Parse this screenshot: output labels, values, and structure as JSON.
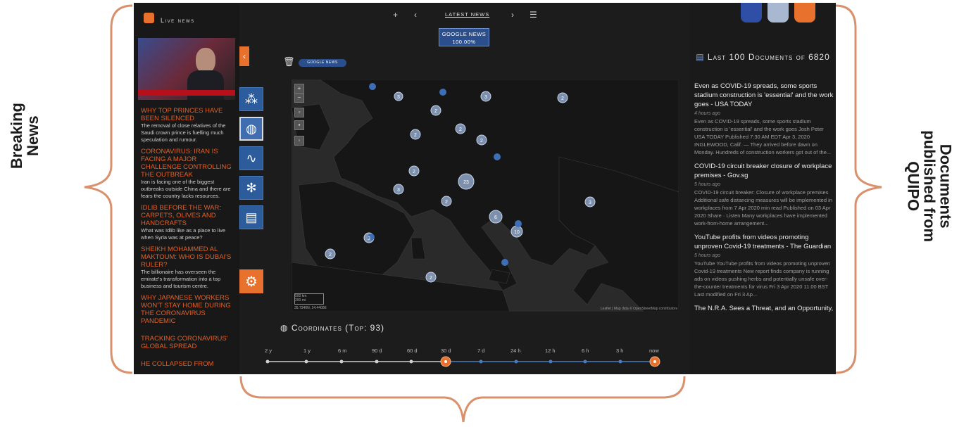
{
  "annotations": {
    "left": "Breaking News",
    "right": "Documents published from QUIPO"
  },
  "colors": {
    "accent": "#e8712d",
    "blue": "#2d5c9c",
    "bracket": "#d9906d"
  },
  "left_panel": {
    "title": "Live news",
    "news": [
      {
        "headline": "Why top princes have been silenced",
        "body": "The removal of close relatives of the Saudi crown prince is fuelling much speculation and rumour."
      },
      {
        "headline": "Coronavirus: Iran is facing a major challenge controlling the outbreak",
        "body": "Iran is facing one of the biggest outbreaks outside China and there are fears the country lacks resources."
      },
      {
        "headline": "Idlib before the war: Carpets, olives and handcrafts",
        "body": "What was Idlib like as a place to live when Syria was at peace?"
      },
      {
        "headline": "Sheikh Mohammed al Maktoum: Who is Dubai's ruler?",
        "body": "The billionaire has overseen the emirate's transformation into a top business and tourism centre."
      },
      {
        "headline": "Why Japanese workers won't stay home during the coronavirus pandemic",
        "body": ""
      },
      {
        "headline": "Tracking coronavirus' global spread",
        "body": ""
      },
      {
        "headline": "He collapsed from",
        "body": ""
      }
    ]
  },
  "center": {
    "nav": {
      "plus": "+",
      "prev": "‹",
      "title": "LATEST NEWS",
      "next": "›",
      "list": "☰"
    },
    "source_box": {
      "name": "GOOGLE NEWS",
      "percent": "100.00%"
    },
    "filter_pill": "GOOGLE NEWS",
    "map": {
      "attribution": "Leaflet | Map data © OpenStreetMap contributors",
      "scale_km": "500 km",
      "scale_mi": "200 mi",
      "coords_readout": "35.7340N, 14.4400E",
      "clusters": [
        "3",
        "3",
        "2",
        "2",
        "2",
        "3",
        "2",
        "2",
        "23",
        "2",
        "6",
        "10",
        "2",
        "2",
        "3",
        "2",
        "2"
      ]
    },
    "coordinates_title": "Coordinates (Top: 93)",
    "timeline": [
      "2 y",
      "1 y",
      "6 m",
      "90 d",
      "60 d",
      "30 d",
      "7 d",
      "24 h",
      "12 h",
      "6 h",
      "3 h",
      "now"
    ]
  },
  "right_panel": {
    "title": "Last 100 Documents of 6820",
    "docs": [
      {
        "title": "Even as COVID-19 spreads, some sports stadium construction is 'essential' and the work goes - USA TODAY",
        "time": "4 hours ago",
        "body": "Even as COVID-19 spreads, some sports stadium construction is 'essential' and the work goes Josh Peter USA TODAY Published 7:30 AM EDT Apr 3, 2020 INGLEWOOD, Calif. — They arrived before dawn on Monday. Hundreds of construction workers got out of the..."
      },
      {
        "title": "COVID-19 circuit breaker closure of workplace premises - Gov.sg",
        "time": "5 hours ago",
        "body": "COVID-19 circuit breaker: Closure of workplace premises Additional safe distancing measures will be implemented in workplaces from 7 Apr 2020 min read Published on 03 Apr 2020 Share · Listen Many workplaces have implemented work-from-home arrangement..."
      },
      {
        "title": "YouTube profits from videos promoting unproven Covid-19 treatments - The Guardian",
        "time": "5 hours ago",
        "body": "YouTube YouTube profits from videos promoting unproven Covid-19 treatments New report finds company is running ads on videos pushing herbs and potentially unsafe over-the-counter treatments for virus Fri 3 Apr 2020 11.00 BST Last modified on Fri 3 Ap..."
      },
      {
        "title": "The N.R.A. Sees a Threat, and an Opportunity,",
        "time": "",
        "body": ""
      }
    ]
  }
}
